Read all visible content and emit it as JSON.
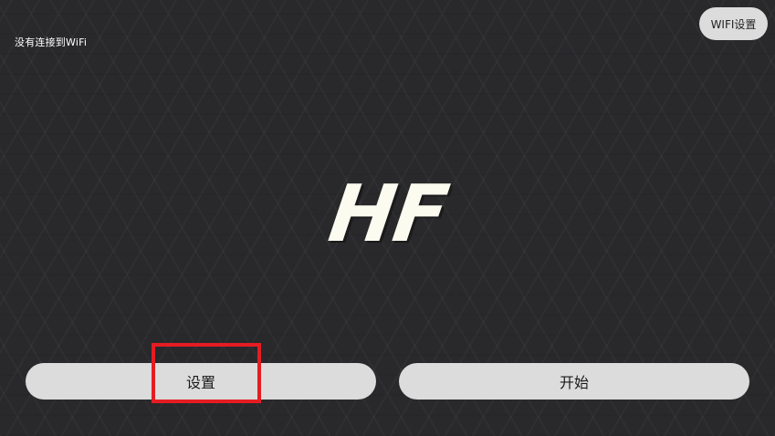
{
  "status": {
    "wifi_status_text": "没有连接到WiFi"
  },
  "header": {
    "wifi_settings_label": "WIFI设置"
  },
  "logo": {
    "text": "HF"
  },
  "actions": {
    "settings_label": "设置",
    "start_label": "开始"
  },
  "colors": {
    "background": "#29292c",
    "button_background": "#dcdcdc",
    "logo_color": "#fbfbef",
    "highlight": "#e51d22"
  }
}
